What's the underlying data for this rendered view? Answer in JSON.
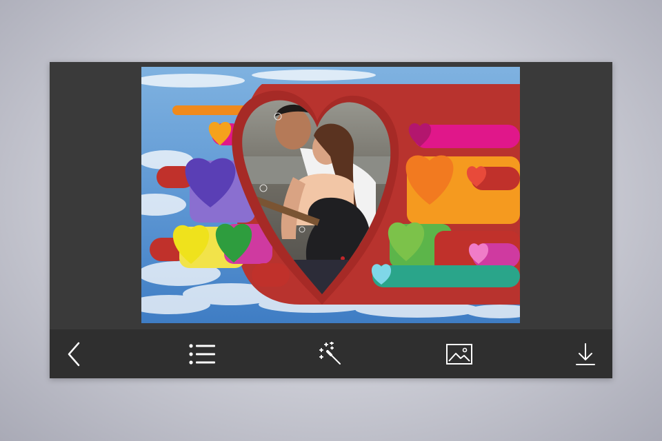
{
  "frame": {
    "name": "heart-rainbow-frame",
    "colors": {
      "frame_red": "#b8332e",
      "sky_top": "#6fa6da",
      "sky_bottom": "#3f7dc4"
    }
  },
  "toolbar": {
    "items": [
      {
        "id": "back",
        "icon": "chevron-left-icon"
      },
      {
        "id": "frames-list",
        "icon": "list-icon"
      },
      {
        "id": "effects",
        "icon": "magic-wand-icon"
      },
      {
        "id": "gallery",
        "icon": "image-icon"
      },
      {
        "id": "save",
        "icon": "download-icon"
      }
    ],
    "icon_color": "#ffffff"
  }
}
